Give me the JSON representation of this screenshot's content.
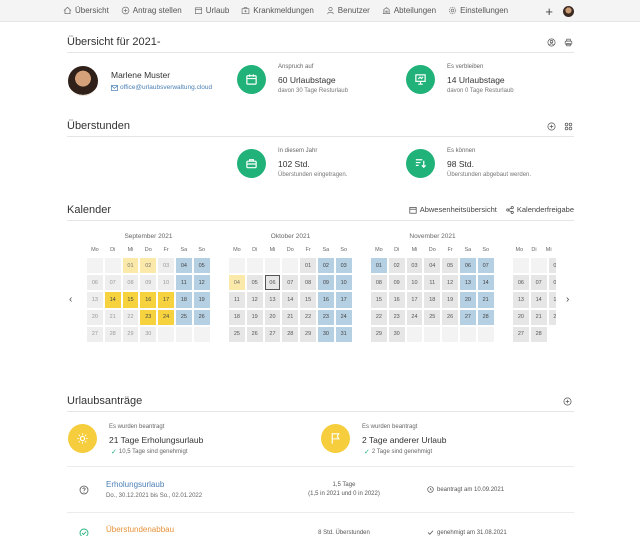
{
  "nav": {
    "items": [
      {
        "label": "Übersicht",
        "icon": "home-icon"
      },
      {
        "label": "Antrag stellen",
        "icon": "plus-circle-icon"
      },
      {
        "label": "Urlaub",
        "icon": "calendar-icon"
      },
      {
        "label": "Krankmeldungen",
        "icon": "medkit-icon"
      },
      {
        "label": "Benutzer",
        "icon": "user-icon"
      },
      {
        "label": "Abteilungen",
        "icon": "building-icon"
      },
      {
        "label": "Einstellungen",
        "icon": "gear-icon"
      }
    ],
    "add": "+"
  },
  "overview": {
    "title": "Übersicht für 2021-",
    "name": "Marlene Muster",
    "email": "office@urlaubsverwaltung.cloud",
    "claim_caption": "Anspruch auf",
    "claim_value": "60 Urlaubstage",
    "claim_sub": "davon 30 Tage Resturlaub",
    "remain_caption": "Es verbleiben",
    "remain_value": "14 Urlaubstage",
    "remain_sub": "davon 0 Tage Resturlaub"
  },
  "overtime": {
    "title": "Überstunden",
    "year_caption": "In diesem Jahr",
    "year_value": "102 Std.",
    "year_sub": "Überstunden eingetragen.",
    "can_caption": "Es können",
    "can_value": "98 Std.",
    "can_sub": "Überstunden abgebaut werden."
  },
  "calendar": {
    "title": "Kalender",
    "action_absence": "Abwesenheitsübersicht",
    "action_share": "Kalenderfreigabe",
    "prev": "‹",
    "next": "›",
    "weekdays": [
      "Mo",
      "Di",
      "Mi",
      "Do",
      "Fr",
      "Sa",
      "So"
    ],
    "months": [
      {
        "name": "September 2021"
      },
      {
        "name": "Oktober 2021"
      },
      {
        "name": "November 2021"
      },
      {
        "name": ""
      }
    ]
  },
  "requests": {
    "title": "Urlaubsanträge",
    "left_caption": "Es wurden beantragt",
    "left_value": "21 Tage Erholungsurlaub",
    "left_sub": "10,5 Tage sind genehmigt",
    "right_caption": "Es wurden beantragt",
    "right_value": "2 Tage anderer Urlaub",
    "right_sub": "2 Tage sind genehmigt",
    "check": "✓",
    "rows": [
      {
        "type": "Erholungsurlaub",
        "dates": "Do., 30.12.2021 bis So., 02.01.2022",
        "days": "1,5 Tage",
        "days_sub": "(1,5 in 2021 und 0 in 2022)",
        "status": "beantragt am 10.09.2021"
      },
      {
        "type": "Überstundenabbau",
        "dates": "",
        "days": "8 Std. Überstunden",
        "days_sub": "",
        "status": "genehmigt am 31.08.2021"
      }
    ]
  },
  "colors": {
    "green": "#21b27a",
    "yellow": "#f5cd3d",
    "weekend": "#b6d0e3",
    "link": "#4a7fb5",
    "orange": "#e8923a"
  }
}
